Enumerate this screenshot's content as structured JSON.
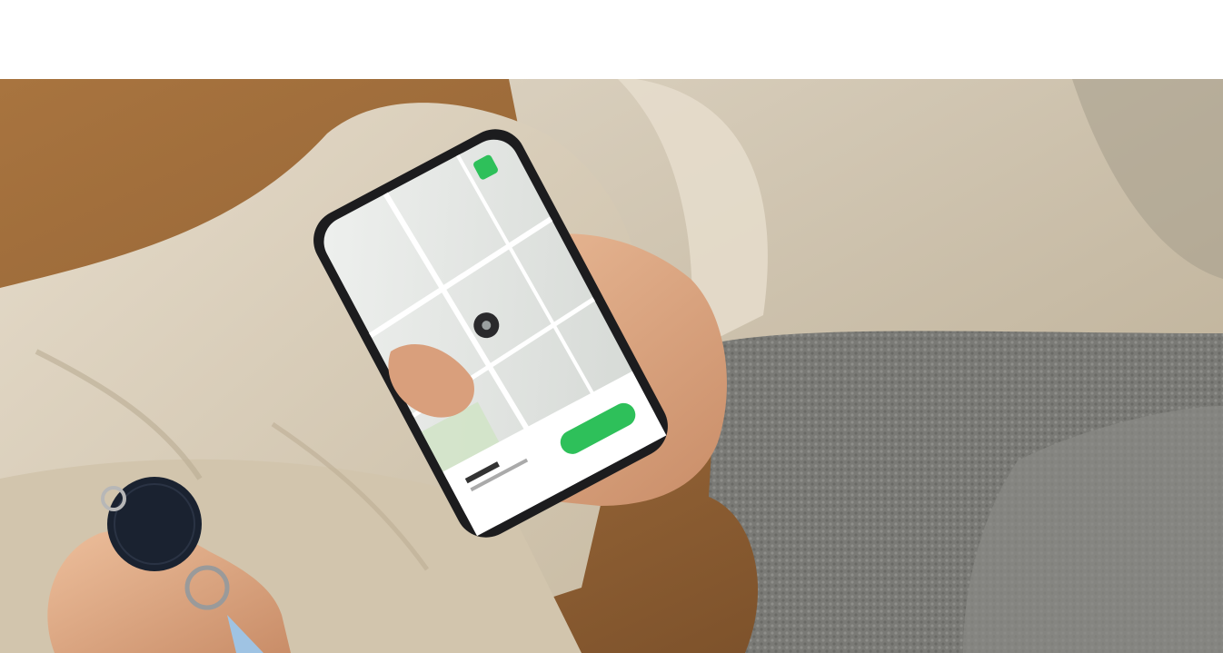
{
  "page": {
    "background": "#ffffff"
  },
  "photo": {
    "subject": "hand-holding-phone-with-map-and-key-tracker",
    "colors": {
      "wood": "#9a6a3c",
      "sofa": "#cfc3ae",
      "pants": "#d8ccb6",
      "skin": "#e0ad8a",
      "sweater": "#7c7c78",
      "phone_frame": "#1c1c1e",
      "map": "#e3e5e3",
      "accent_green": "#2ec05a",
      "tracker": "#1a2230"
    }
  }
}
